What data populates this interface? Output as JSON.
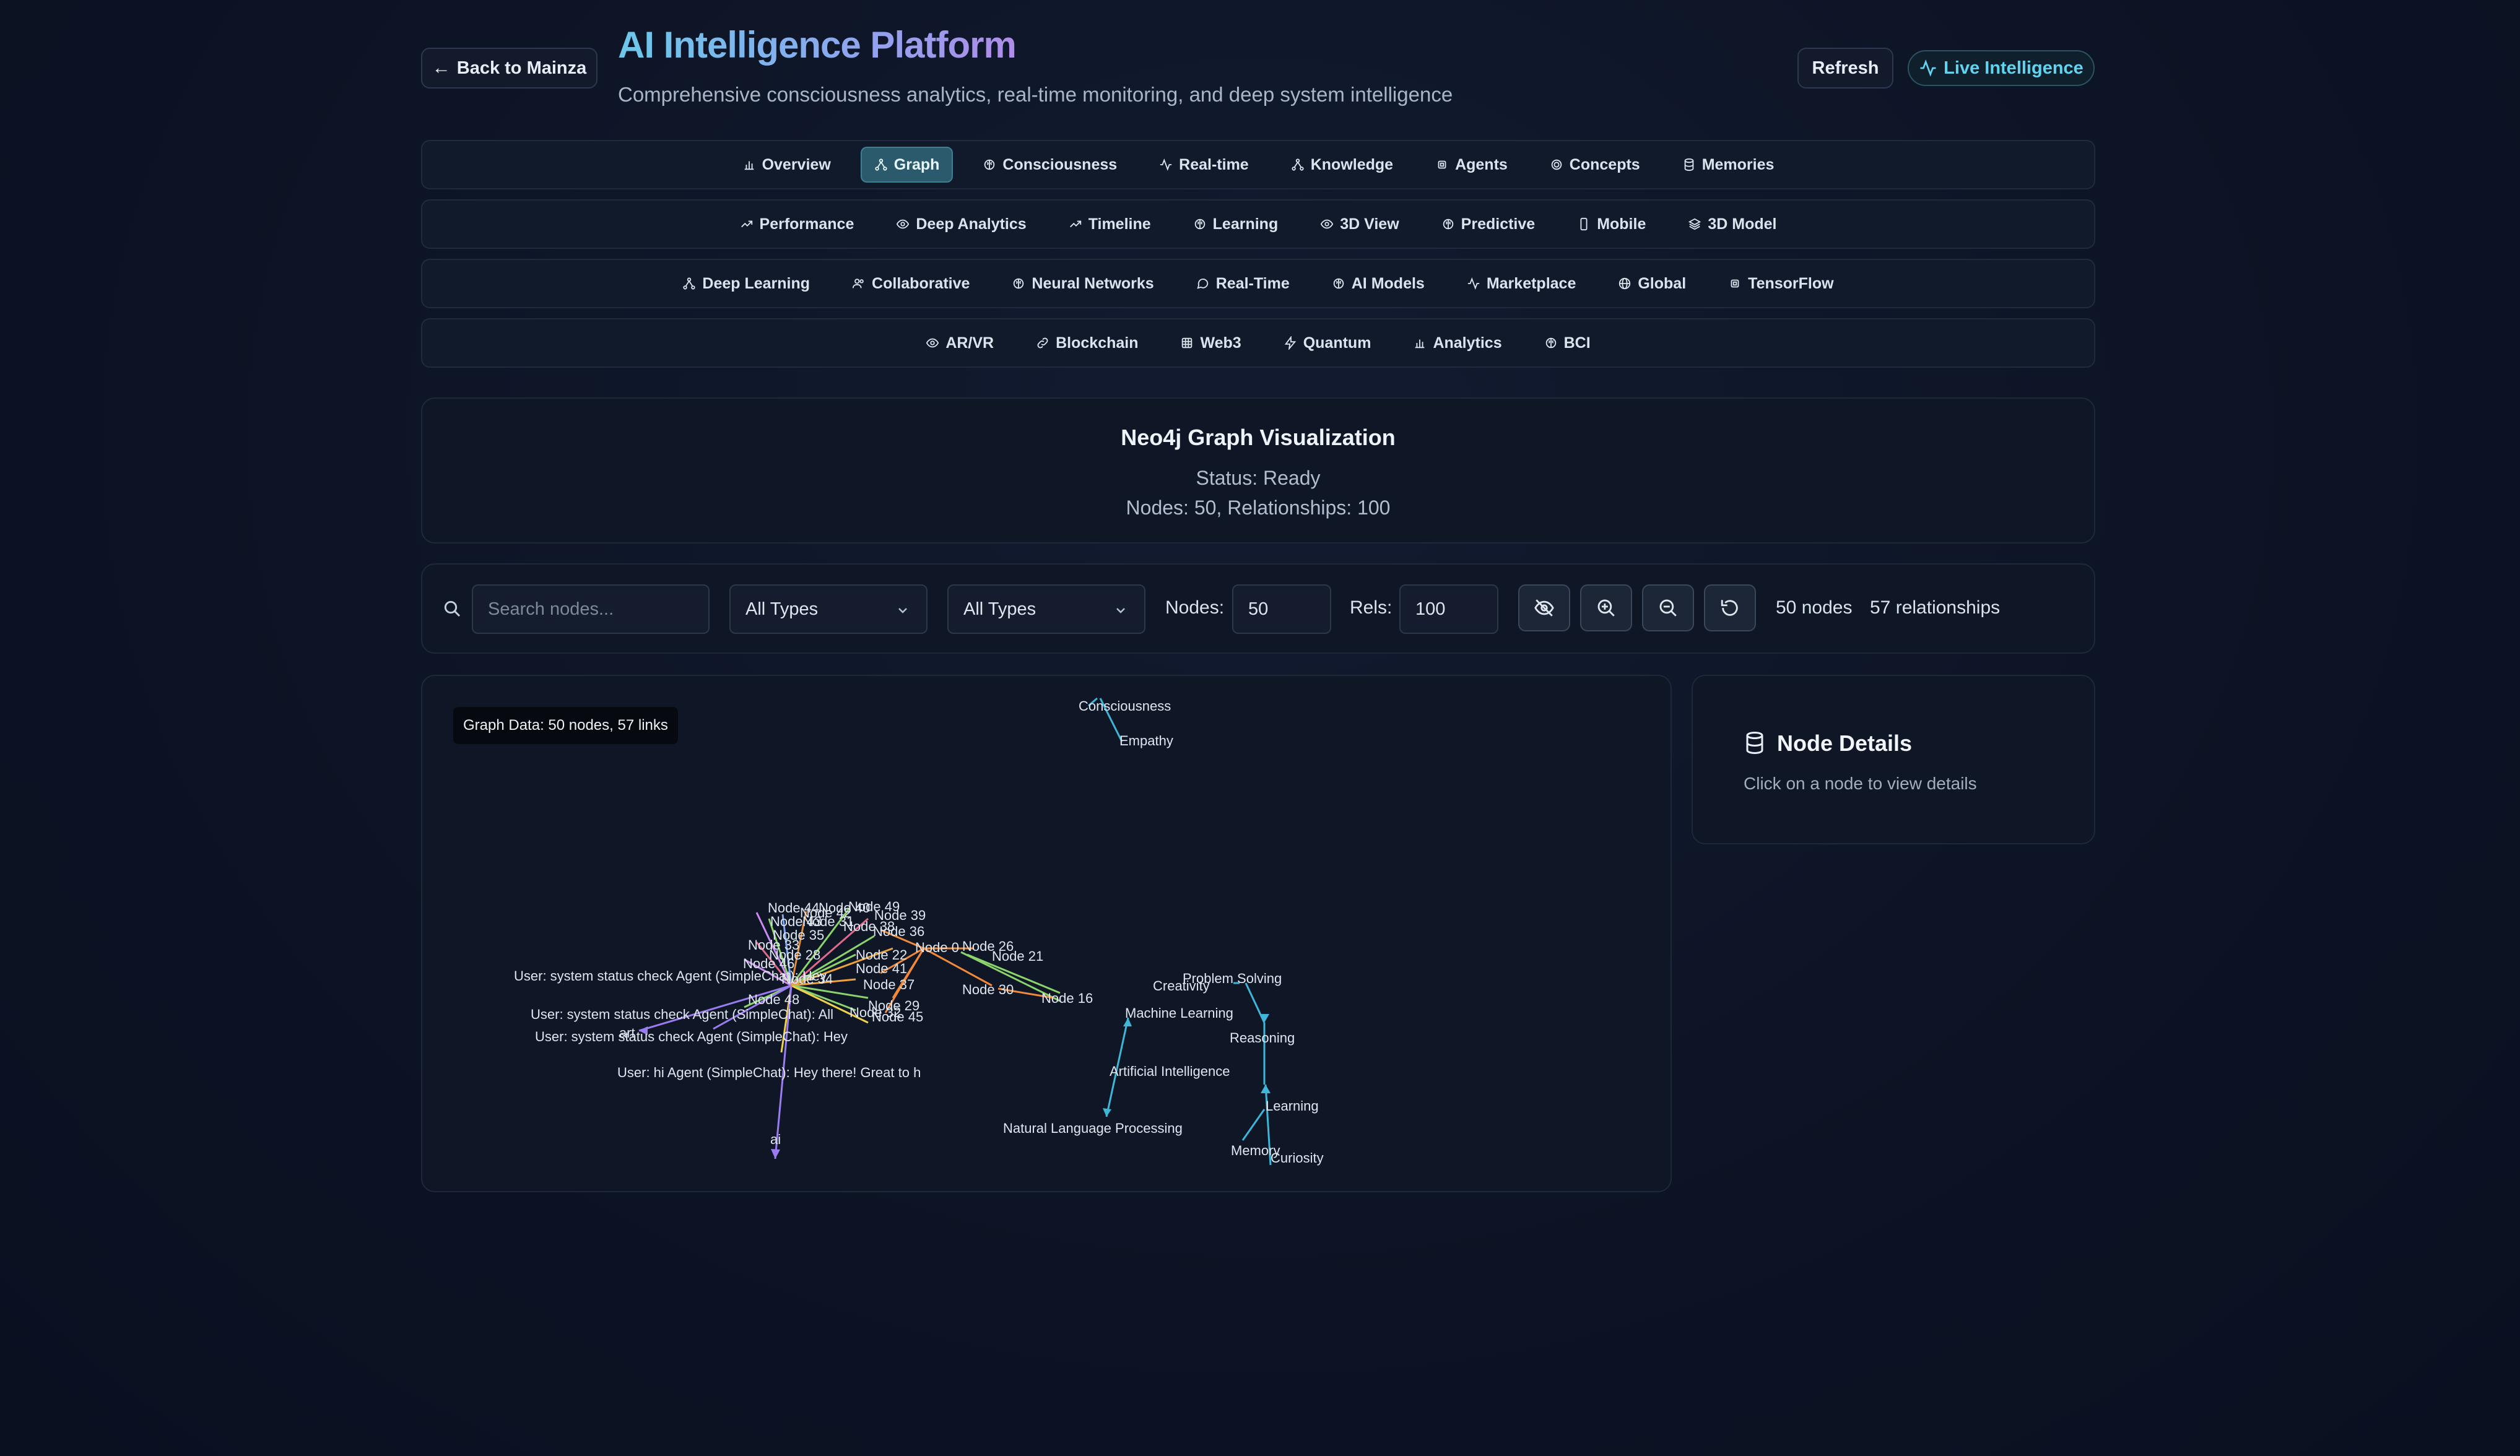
{
  "header": {
    "back_label": "Back to Mainza",
    "title": "AI Intelligence Platform",
    "subtitle": "Comprehensive consciousness analytics, real-time monitoring, and deep system intelligence",
    "refresh_label": "Refresh",
    "live_label": "Live Intelligence"
  },
  "tabs": {
    "row1": [
      {
        "label": "Overview",
        "icon": "bar-chart-icon"
      },
      {
        "label": "Graph",
        "icon": "network-icon",
        "active": true
      },
      {
        "label": "Consciousness",
        "icon": "brain-icon"
      },
      {
        "label": "Real-time",
        "icon": "activity-icon"
      },
      {
        "label": "Knowledge",
        "icon": "network-icon"
      },
      {
        "label": "Agents",
        "icon": "cpu-icon"
      },
      {
        "label": "Concepts",
        "icon": "target-icon"
      },
      {
        "label": "Memories",
        "icon": "database-icon"
      }
    ],
    "row2": [
      {
        "label": "Performance",
        "icon": "trending-up-icon"
      },
      {
        "label": "Deep Analytics",
        "icon": "eye-icon"
      },
      {
        "label": "Timeline",
        "icon": "trending-up-icon"
      },
      {
        "label": "Learning",
        "icon": "brain-icon"
      },
      {
        "label": "3D View",
        "icon": "eye-icon"
      },
      {
        "label": "Predictive",
        "icon": "brain-icon"
      },
      {
        "label": "Mobile",
        "icon": "smartphone-icon"
      },
      {
        "label": "3D Model",
        "icon": "layers-icon"
      }
    ],
    "row3": [
      {
        "label": "Deep Learning",
        "icon": "network-icon"
      },
      {
        "label": "Collaborative",
        "icon": "users-icon"
      },
      {
        "label": "Neural Networks",
        "icon": "brain-icon"
      },
      {
        "label": "Real-Time",
        "icon": "message-icon"
      },
      {
        "label": "AI Models",
        "icon": "brain-icon"
      },
      {
        "label": "Marketplace",
        "icon": "activity-icon"
      },
      {
        "label": "Global",
        "icon": "globe-icon"
      },
      {
        "label": "TensorFlow",
        "icon": "cpu-icon"
      }
    ],
    "row4": [
      {
        "label": "AR/VR",
        "icon": "eye-icon"
      },
      {
        "label": "Blockchain",
        "icon": "link-icon"
      },
      {
        "label": "Web3",
        "icon": "grid-icon"
      },
      {
        "label": "Quantum",
        "icon": "zap-icon"
      },
      {
        "label": "Analytics",
        "icon": "bar-chart-icon"
      },
      {
        "label": "BCI",
        "icon": "brain-icon"
      }
    ]
  },
  "status_card": {
    "title": "Neo4j Graph Visualization",
    "status": "Status: Ready",
    "counts": "Nodes: 50, Relationships: 100"
  },
  "controls": {
    "search_placeholder": "Search nodes...",
    "node_type_select": "All Types",
    "rel_type_select": "All Types",
    "nodes_label": "Nodes:",
    "nodes_value": "50",
    "rels_label": "Rels:",
    "rels_value": "100",
    "nodes_count": "50 nodes",
    "rels_count": "57 relationships"
  },
  "graph": {
    "badge": "Graph Data: 50 nodes, 57 links",
    "labels": [
      "Consciousness",
      "Empathy",
      "Node 49",
      "Node 44",
      "Node 43",
      "Node 42",
      "Node 40",
      "Node 39",
      "Node 38",
      "Node 36",
      "Node 35",
      "Node 33",
      "Node 31",
      "Node 29",
      "Node 28",
      "Node 26",
      "Node 22",
      "Node 21",
      "Node 37",
      "Node 41",
      "Node 46",
      "Node 48",
      "Node 45",
      "Node 34",
      "Node 30",
      "Node 16",
      "Node 0",
      "Node 32",
      "User: system status check Agent (SimpleChat): Hey",
      "User: system status check Agent (SimpleChat): All",
      "User: system status check Agent (SimpleChat): Hey",
      "User: hi Agent (SimpleChat): Hey there! Great to h",
      "ai",
      "art",
      "Creativity",
      "Problem Solving",
      "Machine Learning",
      "Reasoning",
      "Artificial Intelligence",
      "Learning",
      "Natural Language Processing",
      "Memory",
      "Curiosity"
    ]
  },
  "node_details": {
    "title": "Node Details",
    "hint": "Click on a node to view details"
  }
}
